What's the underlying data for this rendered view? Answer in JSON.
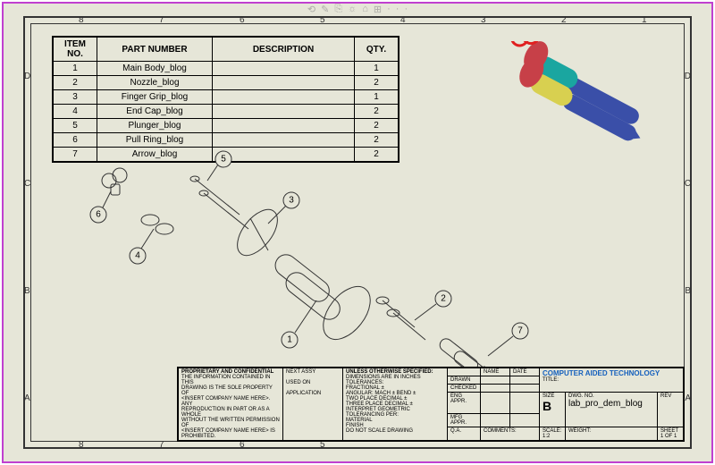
{
  "bom": {
    "headers": {
      "item": "ITEM NO.",
      "part": "PART NUMBER",
      "desc": "DESCRIPTION",
      "qty": "QTY."
    },
    "rows": [
      {
        "item": "1",
        "part": "Main Body_blog",
        "desc": "",
        "qty": "1"
      },
      {
        "item": "2",
        "part": "Nozzle_blog",
        "desc": "",
        "qty": "2"
      },
      {
        "item": "3",
        "part": "Finger Grip_blog",
        "desc": "",
        "qty": "1"
      },
      {
        "item": "4",
        "part": "End Cap_blog",
        "desc": "",
        "qty": "2"
      },
      {
        "item": "5",
        "part": "Plunger_blog",
        "desc": "",
        "qty": "2"
      },
      {
        "item": "6",
        "part": "Pull Ring_blog",
        "desc": "",
        "qty": "2"
      },
      {
        "item": "7",
        "part": "Arrow_blog",
        "desc": "",
        "qty": "2"
      }
    ]
  },
  "balloons": {
    "b1": "1",
    "b2": "2",
    "b3": "3",
    "b4": "4",
    "b5": "5",
    "b6": "6",
    "b7": "7"
  },
  "titleblock": {
    "unless": "UNLESS OTHERWISE SPECIFIED:",
    "dims": "DIMENSIONS ARE IN INCHES",
    "tol": "TOLERANCES:",
    "frac": "FRACTIONAL ±",
    "ang": "ANGULAR: MACH ±   BEND ±",
    "two": "TWO PLACE DECIMAL    ±",
    "three": "THREE PLACE DECIMAL  ±",
    "geo": "INTERPRET GEOMETRIC",
    "geo2": "TOLERANCING PER:",
    "mat": "MATERIAL",
    "fin": "FINISH",
    "dnsd": "DO NOT SCALE DRAWING",
    "prop_h": "PROPRIETARY AND CONFIDENTIAL",
    "prop_t1": "THE INFORMATION CONTAINED IN THIS",
    "prop_t2": "DRAWING IS THE SOLE PROPERTY OF",
    "prop_t3": "<INSERT COMPANY NAME HERE>.  ANY",
    "prop_t4": "REPRODUCTION IN PART OR AS A WHOLE",
    "prop_t5": "WITHOUT THE WRITTEN PERMISSION OF",
    "prop_t6": "<INSERT COMPANY NAME HERE> IS",
    "prop_t7": "PROHIBITED.",
    "next": "NEXT ASSY",
    "used": "USED ON",
    "app": "APPLICATION",
    "name_h": "NAME",
    "date_h": "DATE",
    "drawn": "DRAWN",
    "checked": "CHECKED",
    "enga": "ENG APPR.",
    "mfga": "MFG APPR.",
    "qa": "Q.A.",
    "comm": "COMMENTS:",
    "logo": "COMPUTER AIDED TECHNOLOGY",
    "title_h": "TITLE:",
    "size_h": "SIZE",
    "size": "B",
    "dwg_h": "DWG.  NO.",
    "dwg": "lab_pro_dem_blog",
    "rev_h": "REV",
    "scale_h": "SCALE: 1:2",
    "weight_h": "WEIGHT:",
    "sheet": "SHEET 1 OF 1"
  },
  "zones": {
    "A": "A",
    "B": "B",
    "C": "C",
    "D": "D",
    "n1": "1",
    "n2": "2",
    "n3": "3",
    "n4": "4",
    "n5": "5",
    "n6": "6",
    "n7": "7",
    "n8": "8"
  },
  "toolbar": {
    "i1": "⟲",
    "i2": "✎",
    "i3": "⎘",
    "i4": "☼",
    "i5": "⌂",
    "i6": "⊞",
    "i7": "·",
    "i8": "·",
    "i9": "·"
  }
}
